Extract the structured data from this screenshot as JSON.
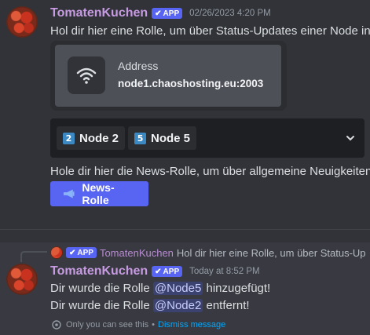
{
  "message1": {
    "username": "TomatenKuchen",
    "badge": "APP",
    "timestamp": "02/26/2023 4:20 PM",
    "text": "Hol dir hier eine Rolle, um über Status-Updates einer Node info",
    "embed": {
      "label": "Address",
      "value": "node1.chaoshosting.eu:2003",
      "icon": "wifi-icon"
    },
    "select": {
      "chips": [
        {
          "num": "2",
          "label": "Node 2"
        },
        {
          "num": "5",
          "label": "Node 5"
        }
      ],
      "chevron": "chevron-down-icon"
    },
    "text2": "Hole dir hier die News-Rolle, um über allgemeine Neuigkeiten",
    "news_button": {
      "icon": "megaphone-icon",
      "label": "News-Rolle"
    }
  },
  "message2": {
    "reply": {
      "badge": "APP",
      "username": "TomatenKuchen",
      "text": "Hol dir hier eine Rolle, um über Status-Up"
    },
    "username": "TomatenKuchen",
    "badge": "APP",
    "timestamp": "Today at 8:52 PM",
    "line1": {
      "pre": "Dir wurde die Rolle ",
      "mention": "@Node5",
      "post": " hinzugefügt!"
    },
    "line2": {
      "pre": "Dir wurde die Rolle ",
      "mention": "@Node2",
      "post": " entfernt!"
    },
    "ephemeral": {
      "text": "Only you can see this",
      "sep": "•",
      "dismiss": "Dismiss message"
    }
  },
  "colors": {
    "background": "#313338",
    "username": "#c79be2",
    "accent": "#5865f2",
    "mention_bg": "#3c4270",
    "link": "#00a8fc"
  }
}
